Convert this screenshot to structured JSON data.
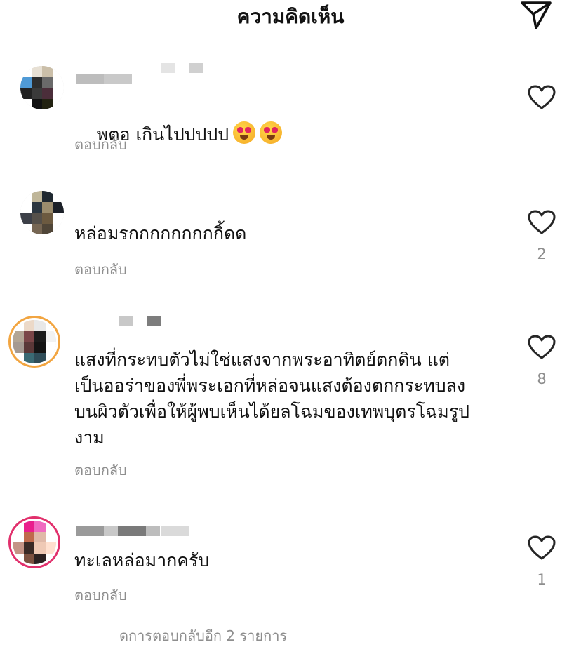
{
  "header": {
    "title": "ความคิดเห็น"
  },
  "comments": [
    {
      "text": "พตอ เกินไปปปปป",
      "emojis": [
        "heart-eyes-emoji",
        "heart-eyes-emoji"
      ],
      "reply": "ตอบกลับ",
      "likes": ""
    },
    {
      "text": "หล่อมรกกกกกกกกกิ้ดด",
      "reply": "ตอบกลับ",
      "likes": "2"
    },
    {
      "text": "แสงที่กระทบตัวไม่ใช่แสงจากพระอาทิตย์ตกดิน แต่\nเป็นออร่าของพี่พระเอกที่หล่อจนแสงต้องตกกระทบลง\nบนผิวตัวเพื่อให้ผู้พบเห็นได้ยลโฉมของเทพบุตรโฉมรูป\nงาม",
      "reply": "ตอบกลับ",
      "likes": "8"
    },
    {
      "text": "ทะเลหล่อมากครับ",
      "reply": "ตอบกลับ",
      "likes": "1"
    }
  ],
  "view_replies": "ดการตอบกลับอีก 2 รายการ",
  "colors": {
    "muted": "#8e8e8e",
    "divider": "#dbdbdb",
    "story_ring": "#e1306c"
  },
  "icons": {
    "send": "send-icon",
    "like": "heart-outline-icon"
  }
}
